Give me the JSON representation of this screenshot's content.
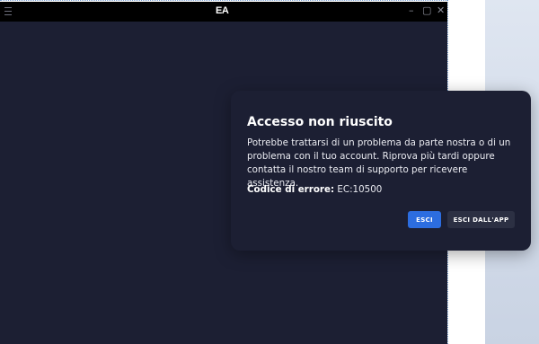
{
  "window": {
    "logo": "EA",
    "controls": {
      "minimize": "–",
      "maximize": "▢",
      "close": "✕"
    }
  },
  "dialog": {
    "title": "Accesso non riuscito",
    "message": "Potrebbe trattarsi di un problema da parte nostra o di un problema con il tuo account. Riprova più tardi oppure contatta il nostro team di supporto per ricevere assistenza.",
    "error_label": "Codice di errore:",
    "error_code": "EC:10500",
    "buttons": {
      "primary": "ESCI",
      "secondary": "ESCI DALL'APP"
    }
  },
  "colors": {
    "window_bg": "#1c1f33",
    "titlebar_bg": "#000000",
    "primary_button": "#2c6de0",
    "secondary_button": "#2c3043"
  }
}
